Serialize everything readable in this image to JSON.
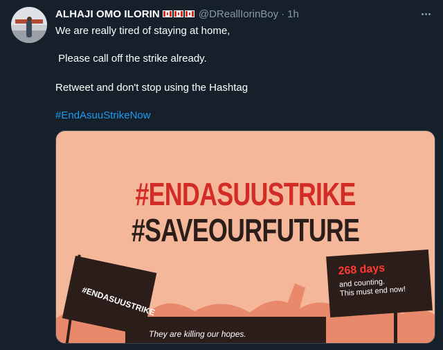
{
  "tweet": {
    "display_name": "ALHAJI OMO ILORIN",
    "flag_icons": [
      "canada-flag-icon",
      "canada-flag-icon",
      "canada-flag-icon"
    ],
    "handle": "@DReallIorinBoy",
    "separator": "·",
    "time": "1h",
    "lines": [
      "We are really tired of staying at home,",
      " Please call off the strike already.",
      "Retweet and don't stop using the Hashtag"
    ],
    "hashtag": "#EndAsuuStrikeNow"
  },
  "media": {
    "headline_1": "#ENDASUUSTRIKE",
    "headline_2": "#SAVEOURFUTURE",
    "flag_label": "#ENDASUUSTRIKE",
    "sign_days": "268 days",
    "sign_line_1": "and counting.",
    "sign_line_2": "This must end now!",
    "banner_text": "They are killing our hopes."
  },
  "colors": {
    "background": "#15202b",
    "hashtag": "#1d9bf0",
    "muted": "#8899a6",
    "media_bg": "#f5b79a",
    "media_red": "#d32b25",
    "media_dark": "#2b1e1a"
  }
}
